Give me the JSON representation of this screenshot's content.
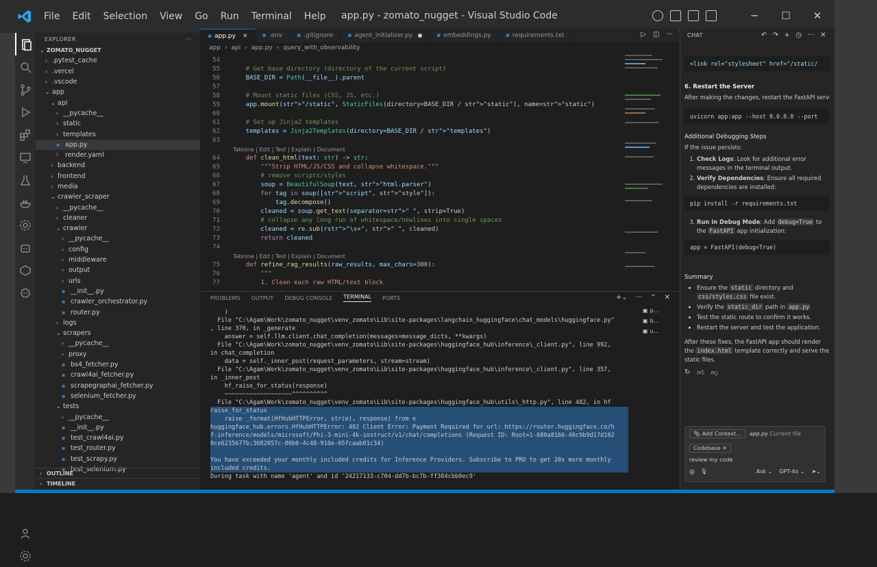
{
  "window": {
    "title": "app.py - zomato_nugget - Visual Studio Code",
    "menu": [
      "File",
      "Edit",
      "Selection",
      "View",
      "Go",
      "Run",
      "Terminal",
      "Help"
    ],
    "controls": [
      "─",
      "☐",
      "✕"
    ]
  },
  "activity": [
    "files-icon",
    "search-icon",
    "source-control-icon",
    "run-debug-icon",
    "extensions-icon",
    "remote-explorer-icon",
    "testing-icon",
    "docker-icon",
    "settings-icon",
    "bot-icon",
    "github-icon",
    "copilot-icon",
    "account-icon",
    "manage-icon"
  ],
  "explorer": {
    "header": "EXPLORER",
    "root": "ZOMATO_NUGGET",
    "outline": "OUTLINE",
    "timeline": "TIMELINE",
    "items": [
      {
        "label": ".pytest_cache",
        "depth": 1,
        "type": "folder",
        "open": false
      },
      {
        "label": ".vercel",
        "depth": 1,
        "type": "folder",
        "open": false
      },
      {
        "label": ".vscode",
        "depth": 1,
        "type": "folder",
        "open": false
      },
      {
        "label": "app",
        "depth": 1,
        "type": "folder",
        "open": true
      },
      {
        "label": "api",
        "depth": 2,
        "type": "folder",
        "open": true
      },
      {
        "label": "__pycache__",
        "depth": 3,
        "type": "folder",
        "open": false
      },
      {
        "label": "static",
        "depth": 3,
        "type": "folder",
        "open": false
      },
      {
        "label": "templates",
        "depth": 3,
        "type": "folder",
        "open": false
      },
      {
        "label": "app.py",
        "depth": 3,
        "type": "py",
        "selected": true
      },
      {
        "label": "render.yaml",
        "depth": 3,
        "type": "yaml"
      },
      {
        "label": "backend",
        "depth": 2,
        "type": "folder",
        "open": false
      },
      {
        "label": "frontend",
        "depth": 2,
        "type": "folder",
        "open": false
      },
      {
        "label": "media",
        "depth": 2,
        "type": "folder",
        "open": false
      },
      {
        "label": "crawler_scraper",
        "depth": 2,
        "type": "folder",
        "open": true
      },
      {
        "label": "__pycache__",
        "depth": 3,
        "type": "folder",
        "open": false
      },
      {
        "label": "cleaner",
        "depth": 3,
        "type": "folder",
        "open": false
      },
      {
        "label": "crawler",
        "depth": 3,
        "type": "folder",
        "open": true
      },
      {
        "label": "__pycache__",
        "depth": 4,
        "type": "folder",
        "open": false
      },
      {
        "label": "config",
        "depth": 4,
        "type": "folder",
        "open": false
      },
      {
        "label": "middleware",
        "depth": 4,
        "type": "folder",
        "open": false
      },
      {
        "label": "output",
        "depth": 4,
        "type": "folder",
        "open": false
      },
      {
        "label": "urls",
        "depth": 4,
        "type": "folder",
        "open": false
      },
      {
        "label": "__init__.py",
        "depth": 4,
        "type": "py"
      },
      {
        "label": "crawler_orchestrator.py",
        "depth": 4,
        "type": "py"
      },
      {
        "label": "router.py",
        "depth": 4,
        "type": "py"
      },
      {
        "label": "logs",
        "depth": 3,
        "type": "folder",
        "open": false
      },
      {
        "label": "scrapers",
        "depth": 3,
        "type": "folder",
        "open": true
      },
      {
        "label": "__pycache__",
        "depth": 4,
        "type": "folder",
        "open": false
      },
      {
        "label": "proxy",
        "depth": 4,
        "type": "folder",
        "open": false
      },
      {
        "label": "bs4_fetcher.py",
        "depth": 4,
        "type": "py"
      },
      {
        "label": "crawl4ai_fetcher.py",
        "depth": 4,
        "type": "py"
      },
      {
        "label": "scrapegraphai_fetcher.py",
        "depth": 4,
        "type": "py"
      },
      {
        "label": "selenium_fetcher.py",
        "depth": 4,
        "type": "py"
      },
      {
        "label": "tests",
        "depth": 3,
        "type": "folder",
        "open": true
      },
      {
        "label": "__pycache__",
        "depth": 4,
        "type": "folder",
        "open": false
      },
      {
        "label": "__init__.py",
        "depth": 4,
        "type": "py"
      },
      {
        "label": "test_crawl4ai.py",
        "depth": 4,
        "type": "py"
      },
      {
        "label": "test_router.py",
        "depth": 4,
        "type": "py"
      },
      {
        "label": "test_scrapy.py",
        "depth": 4,
        "type": "py"
      },
      {
        "label": "test_selenium.py",
        "depth": 4,
        "type": "py"
      }
    ]
  },
  "tabs": [
    {
      "label": "app.py",
      "active": true,
      "close": "✕"
    },
    {
      "label": ".env"
    },
    {
      "label": ".gitignore"
    },
    {
      "label": "agent_initializer.py",
      "dirty": true
    },
    {
      "label": "embeddings.py"
    },
    {
      "label": "requirements.txt"
    }
  ],
  "breadcrumbs": [
    "app",
    "api",
    "app.py",
    "query_with_observability"
  ],
  "codelens": "Tabnine | Edit | Test | Explain | Document",
  "code": [
    {
      "n": "54",
      "t": ""
    },
    {
      "n": "55",
      "t": "    # Get base directory (directory of the current script)",
      "c": "cm"
    },
    {
      "n": "56",
      "t": "    BASE_DIR = Path(__file__).parent"
    },
    {
      "n": "57",
      "t": ""
    },
    {
      "n": "58",
      "t": "    # Mount static files (CSS, JS, etc.)",
      "c": "cm"
    },
    {
      "n": "59",
      "t": "    app.mount(\"/static\", StaticFiles(directory=BASE_DIR / \"static\"), name=\"static\")"
    },
    {
      "n": "60",
      "t": ""
    },
    {
      "n": "61",
      "t": "    # Set up Jinja2 templates",
      "c": "cm"
    },
    {
      "n": "62",
      "t": "    templates = Jinja2Templates(directory=BASE_DIR / \"templates\")"
    },
    {
      "n": "63",
      "t": ""
    },
    {
      "lens": true
    },
    {
      "n": "64",
      "t": "    def clean_html(text: str) -> str:"
    },
    {
      "n": "65",
      "t": "        \"\"\"Strip HTML/JS/CSS and collapse whitespace.\"\"\"",
      "c": "str"
    },
    {
      "n": "66",
      "t": "        # remove scripts/styles",
      "c": "cm"
    },
    {
      "n": "67",
      "t": "        soup = BeautifulSoup(text, \"html.parser\")"
    },
    {
      "n": "68",
      "t": "        for tag in soup([\"script\", \"style\"]):"
    },
    {
      "n": "69",
      "t": "            tag.decompose()"
    },
    {
      "n": "70",
      "t": "        cleaned = soup.get_text(separator=\" \", strip=True)"
    },
    {
      "n": "71",
      "t": "        # collapse any long run of whitespace/newlines into single spaces",
      "c": "cm"
    },
    {
      "n": "72",
      "t": "        cleaned = re.sub(r\"\\s+\", \" \", cleaned)"
    },
    {
      "n": "73",
      "t": "        return cleaned"
    },
    {
      "n": "74",
      "t": ""
    },
    {
      "lens": true
    },
    {
      "n": "75",
      "t": "    def refine_rag_results(raw_results, max_chars=300):"
    },
    {
      "n": "76",
      "t": "        \"\"\"",
      "c": "str"
    },
    {
      "n": "77",
      "t": "        1. Clean each raw HTML/text block",
      "c": "str"
    }
  ],
  "panel": {
    "tabs": [
      "PROBLEMS",
      "OUTPUT",
      "DEBUG CONSOLE",
      "TERMINAL",
      "PORTS"
    ],
    "active": "TERMINAL",
    "terminals": [
      "p...",
      "b...",
      "u..."
    ]
  },
  "terminal": [
    {
      "t": "    )"
    },
    {
      "t": "  File \"C:\\Agam\\Work\\zomato_nugget\\venv_zomato\\Lib\\site-packages\\langchain_huggingface\\chat_models\\huggingface.py\""
    },
    {
      "t": ", line 370, in _generate"
    },
    {
      "t": "    answer = self.llm.client.chat_completion(messages=message_dicts, **kwargs)"
    },
    {
      "t": "  File \"C:\\Agam\\Work\\zomato_nugget\\venv_zomato\\Lib\\site-packages\\huggingface_hub\\inference\\_client.py\", line 992,"
    },
    {
      "t": "in chat_completion"
    },
    {
      "t": "    data = self._inner_post(request_parameters, stream=stream)"
    },
    {
      "t": "  File \"C:\\Agam\\Work\\zomato_nugget\\venv_zomato\\Lib\\site-packages\\huggingface_hub\\inference\\_client.py\", line 357,"
    },
    {
      "t": "in _inner_post"
    },
    {
      "t": "    hf_raise_for_status(response)"
    },
    {
      "t": "    ~~~~~~~~~~~~~~~~~~~^^^^^^^^^^"
    },
    {
      "t": "  File \"C:\\Agam\\Work\\zomato_nugget\\venv_zomato\\Lib\\site-packages\\huggingface_hub\\utils\\_http.py\", line 482, in hf"
    },
    {
      "t": "raise_for_status",
      "hl": true
    },
    {
      "t": "    raise _format(HfHubHTTPError, str(e), response) from e",
      "hl": true
    },
    {
      "t": "huggingface_hub.errors.HfHubHTTPError: 402 Client Error: Payment Required for url: https://router.huggingface.co/h",
      "hl": true
    },
    {
      "t": "f-inference/models/microsoft/Phi-3-mini-4k-instruct/v1/chat/completions (Request ID: Root=1-680a8166-46c9b9d17d102",
      "hl": true
    },
    {
      "t": "0ce6235677b;3682057c-80b0-4c48-910e-65fcaab01c34)",
      "hl": true
    },
    {
      "t": "",
      "hl": true
    },
    {
      "t": "You have exceeded your monthly included credits for Inference Providers. Subscribe to PRO to get 20x more monthly",
      "hl": true
    },
    {
      "t": "included credits.",
      "hl": true
    },
    {
      "t": "During task with name 'agent' and id '24217133-c704-dd7b-bc7b-ff384cbb0ec9'"
    }
  ],
  "chat": {
    "header": "CHAT",
    "link_code": "<link rel=\"stylesheet\" href=\"/static/",
    "step6_title": "6. Restart the Server",
    "step6_text": "After making the changes, restart the FastAPI server:",
    "uvicorn": "uvicorn app:app --host 0.0.0.0 --port",
    "debug_title": "Additional Debugging Steps",
    "debug_intro": "If the issue persists:",
    "check_logs_b": "Check Logs",
    "check_logs": ": Look for additional error messages in the terminal output.",
    "verify_b": "Verify Dependencies",
    "verify": ": Ensure all required dependencies are installed:",
    "pip": "pip install -r requirements.txt",
    "debug_mode_b": "Run in Debug Mode",
    "debug_mode_1": ": Add",
    "debug_mode_code": "debug=True",
    "debug_mode_2": "to the",
    "debug_mode_code2": "FastAPI",
    "debug_mode_3": "app initialization:",
    "app_code": "app = FastAPI(debug=True)",
    "summary_title": "Summary",
    "s1a": "Ensure the",
    "s1code": "static",
    "s1b": "directory and",
    "s1code2": "css/styles.css",
    "s1c": "file exist.",
    "s2a": "Verify the",
    "s2code": "static_dir",
    "s2b": "path in",
    "s2code2": "app.py",
    "s3": "Test the static route to confirm it works.",
    "s4": "Restart the server and test the application.",
    "closing_a": "After these fixes, the FastAPI app should render the",
    "closing_code": "index.html",
    "closing_b": "template correctly and serve the static files.",
    "add_context": "Add Context...",
    "context_file": "app.py",
    "context_file_sub": "Current file",
    "codebase": "Codebase",
    "input_value": "review my code",
    "mode": "Ask",
    "model": "GPT-4o"
  },
  "colors": {
    "accent": "#007acc",
    "selection": "#264f78"
  }
}
